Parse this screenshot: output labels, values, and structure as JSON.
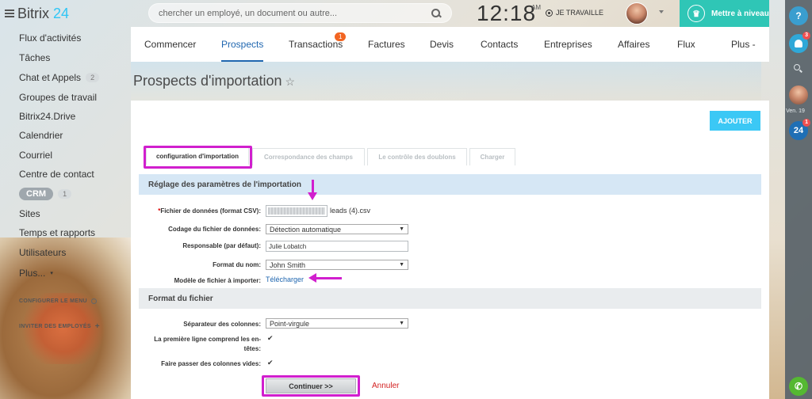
{
  "app": {
    "brand_main": "Bitrix",
    "brand_suffix": "24"
  },
  "header": {
    "search_placeholder": "chercher un employé, un document ou autre...",
    "clock": "12:18",
    "clock_suffix": "AM",
    "work_status": "JE TRAVAILLE",
    "upgrade_label": "Mettre à niveau"
  },
  "sidebar": {
    "items": [
      {
        "label": "Flux d'activités"
      },
      {
        "label": "Tâches"
      },
      {
        "label": "Chat et Appels",
        "badge": "2"
      },
      {
        "label": "Groupes de travail"
      },
      {
        "label": "Bitrix24.Drive"
      },
      {
        "label": "Calendrier"
      },
      {
        "label": "Courriel"
      },
      {
        "label": "Centre de contact"
      },
      {
        "label": "CRM",
        "badge": "1"
      },
      {
        "label": "Sites"
      },
      {
        "label": "Temps et rapports"
      },
      {
        "label": "Utilisateurs"
      },
      {
        "label": "Plus..."
      }
    ],
    "configure_menu": "CONFIGURER LE MENU",
    "invite_users": "INVITER DES EMPLOYÉS"
  },
  "nav": {
    "tabs": [
      {
        "label": "Commencer"
      },
      {
        "label": "Prospects",
        "active": true
      },
      {
        "label": "Transactions",
        "counter": "1"
      },
      {
        "label": "Factures"
      },
      {
        "label": "Devis"
      },
      {
        "label": "Contacts"
      },
      {
        "label": "Entreprises"
      },
      {
        "label": "Affaires"
      },
      {
        "label": "Flux"
      },
      {
        "label": "Plus -"
      }
    ]
  },
  "page": {
    "title": "Prospects d'importation",
    "add_button": "AJOUTER"
  },
  "steps": [
    {
      "label": "configuration d'importation",
      "active": true
    },
    {
      "label": "Correspondance des champs"
    },
    {
      "label": "Le contrôle des doublons"
    },
    {
      "label": "Charger"
    }
  ],
  "import_settings": {
    "section_title": "Réglage des paramètres de l'importation",
    "file_label_required": "*",
    "file_label": "Fichier de données (format CSV):",
    "file_name": "leads (4).csv",
    "encoding_label": "Codage du fichier de données:",
    "encoding_value": "Détection automatique",
    "responsible_label": "Responsable (par défaut):",
    "responsible_value": "Julie Lobatch",
    "name_format_label": "Format du nom:",
    "name_format_value": "John Smith",
    "template_label": "Modèle de fichier à importer:",
    "template_link": "Télécharger"
  },
  "file_format": {
    "section_title": "Format du fichier",
    "separator_label": "Séparateur des colonnes:",
    "separator_value": "Point-virgule",
    "header_row_label_1": "La première ligne comprend les en-",
    "header_row_label_2": "têtes:",
    "header_row_checked": true,
    "skip_empty_label": "Faire passer des colonnes vides:",
    "skip_empty_checked": true
  },
  "actions": {
    "continue": "Continuer >>",
    "cancel": "Annuler"
  },
  "rail": {
    "help": "?",
    "notifications_count": "3",
    "date_label": "Ven. 19",
    "b24_label": "24",
    "b24_count": "1"
  },
  "colors": {
    "accent": "#2067b0",
    "upgrade": "#2fc6b6",
    "add_button": "#3bc8f5",
    "highlight": "#d11fce",
    "cancel": "#d21f1f",
    "counter": "#f26522"
  }
}
